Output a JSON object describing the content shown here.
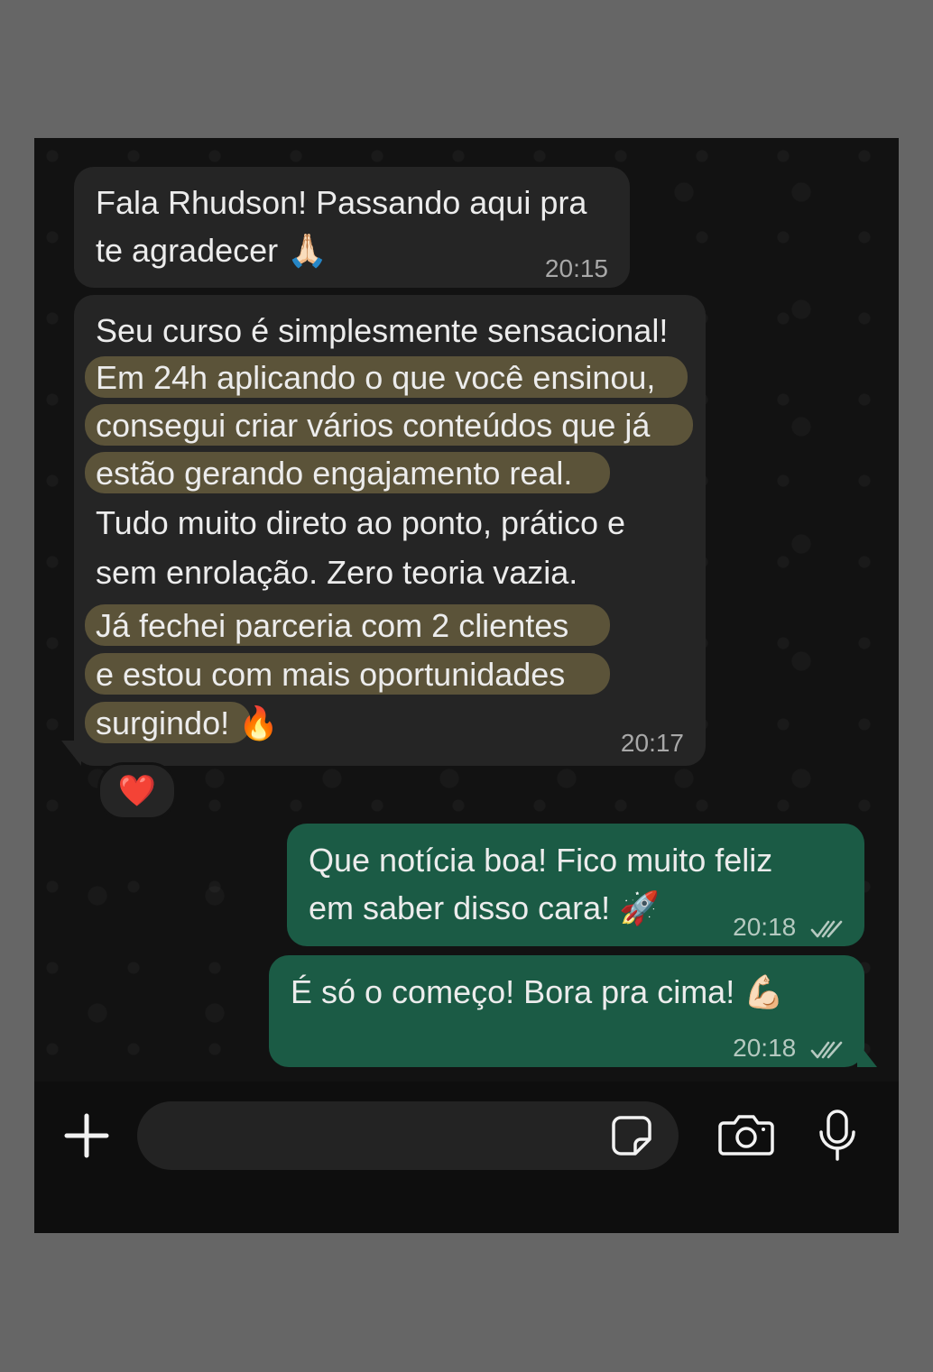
{
  "messages": [
    {
      "direction": "incoming",
      "lines": [
        "Fala Rhudson! Passando aqui pra",
        "te agradecer 🙏🏻"
      ],
      "time": "20:15"
    },
    {
      "direction": "incoming",
      "lines": [
        "Seu curso é simplesmente sensacional!",
        "Em 24h aplicando o que você ensinou,",
        "consegui criar vários conteúdos que já",
        "estão gerando engajamento real.",
        "Tudo muito direto ao ponto, prático e",
        "sem enrolação. Zero teoria vazia.",
        "Já fechei parceria com 2 clientes",
        "e estou com mais oportunidades",
        "surgindo! 🔥"
      ],
      "highlighted_lines": [
        1,
        2,
        3,
        6,
        7,
        8
      ],
      "time": "20:17",
      "reaction": "❤️"
    },
    {
      "direction": "outgoing",
      "lines": [
        "Que notícia boa! Fico muito feliz",
        "em saber disso cara! 🚀"
      ],
      "time": "20:18",
      "status": "read-double-check"
    },
    {
      "direction": "outgoing",
      "lines": [
        "É só o começo! Bora pra cima! 💪🏻"
      ],
      "time": "20:18",
      "status": "read-double-check"
    }
  ],
  "composer": {
    "value": "",
    "placeholder": ""
  },
  "icons": {
    "attach": "plus-icon",
    "sticker": "sticker-icon",
    "camera": "camera-icon",
    "microphone": "microphone-icon",
    "read_status": "double-check-icon"
  },
  "colors": {
    "incoming_bubble": "#252525",
    "outgoing_bubble": "#1b5b45",
    "highlight": "#5b5339",
    "reaction_heart": "#e2263a",
    "background": "#121212"
  }
}
